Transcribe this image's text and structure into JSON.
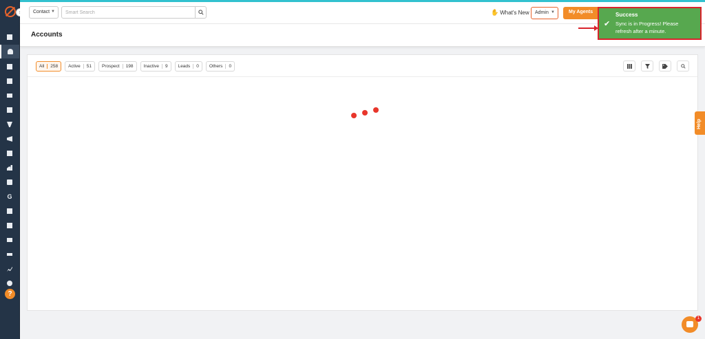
{
  "topbar": {
    "search_type": "Contact",
    "search_placeholder": "Smart Search",
    "whats_new": "What's New",
    "role": "Admin",
    "agents_label": "My Agents"
  },
  "page": {
    "title": "Accounts"
  },
  "filters": [
    {
      "label": "All",
      "count": "258",
      "active": true
    },
    {
      "label": "Active",
      "count": "51"
    },
    {
      "label": "Prospect",
      "count": "198"
    },
    {
      "label": "Inactive",
      "count": "9"
    },
    {
      "label": "Leads",
      "count": "0"
    },
    {
      "label": "Others",
      "count": "0"
    }
  ],
  "toast": {
    "title": "Success",
    "message": "Sync is in Progress! Please refresh after a minute."
  },
  "help": {
    "label": "Help"
  },
  "chat": {
    "badge": "1"
  },
  "colors": {
    "accent": "#f28c28",
    "sidebar": "#243447",
    "toast_bg": "#57a84f",
    "highlight": "#d9232b",
    "spinner": "#e8362b"
  },
  "sidebar_icons": [
    "dashboard-icon",
    "contacts-icon",
    "documents-icon",
    "bank-icon",
    "list-icon",
    "contact-card-icon",
    "funnel-icon",
    "megaphone-icon",
    "notes-icon",
    "chart-bars-icon",
    "folder-icon",
    "google-icon",
    "calendar-grid-icon",
    "calendar-icon",
    "mail-icon",
    "handshake-icon",
    "trend-icon",
    "gear-icon",
    "help-icon"
  ]
}
